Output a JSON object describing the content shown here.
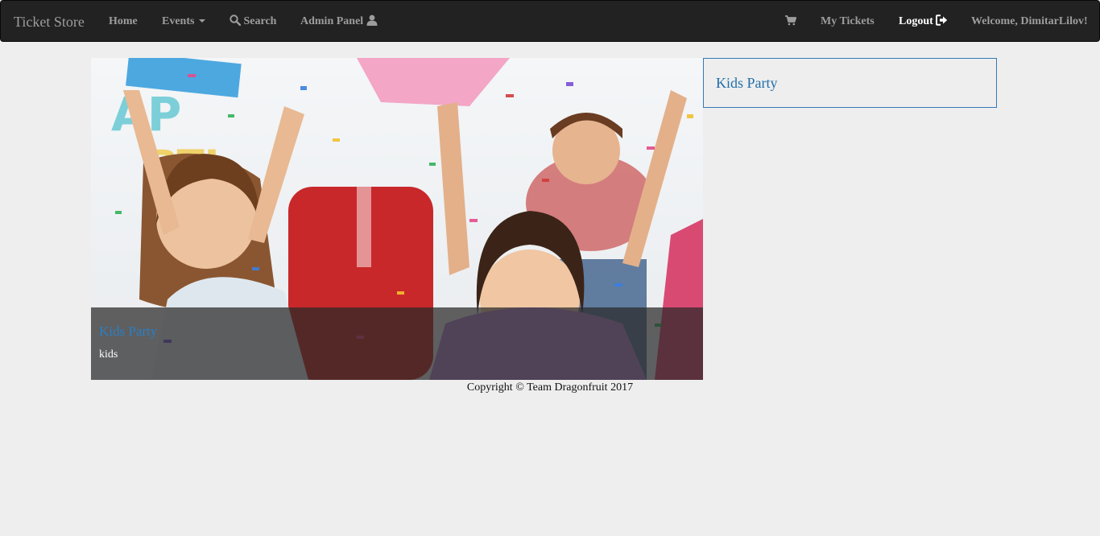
{
  "navbar": {
    "brand": "Ticket Store",
    "home": "Home",
    "events": "Events",
    "search": "Search",
    "admin_panel": "Admin Panel",
    "my_tickets": "My Tickets",
    "logout": "Logout",
    "welcome": "Welcome, DimitarLilov!"
  },
  "event": {
    "caption_title": "Kids Party",
    "caption_text": "kids"
  },
  "side_panel": {
    "title": "Kids Party"
  },
  "footer": {
    "text": "Copyright © Team Dragonfruit 2017"
  },
  "colors": {
    "navbar_bg": "#222222",
    "nav_text": "#9d9d9d",
    "link_blue": "#337ab7",
    "page_bg": "#eeeeee"
  },
  "icons": {
    "events": "caret-down-icon",
    "search": "search-icon",
    "admin_panel": "user-icon",
    "cart": "shopping-cart-icon",
    "logout": "logout-icon"
  }
}
